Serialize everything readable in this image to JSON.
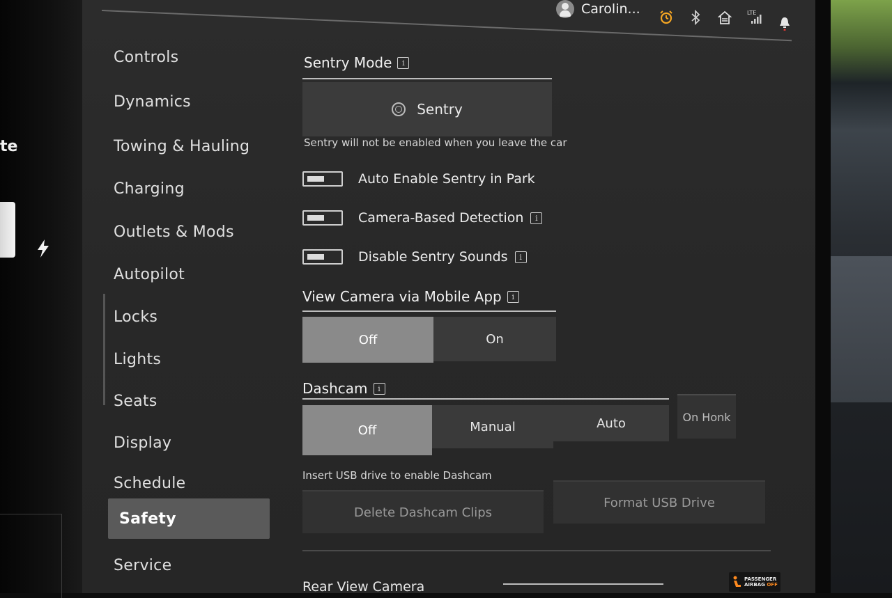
{
  "edge_fragment": "te",
  "user": {
    "name": "Carolin..."
  },
  "status_icons": [
    "alarm-clock-icon",
    "bluetooth-icon",
    "homelink-icon",
    "lte-signal-icon",
    "bell-icon"
  ],
  "status": {
    "network": "LTE"
  },
  "sidebar": {
    "items": [
      {
        "label": "Controls"
      },
      {
        "label": "Dynamics"
      },
      {
        "label": "Towing & Hauling"
      },
      {
        "label": "Charging"
      },
      {
        "label": "Outlets & Mods"
      },
      {
        "label": "Autopilot"
      },
      {
        "label": "Locks"
      },
      {
        "label": "Lights"
      },
      {
        "label": "Seats"
      },
      {
        "label": "Display"
      },
      {
        "label": "Schedule"
      },
      {
        "label": "Safety",
        "active": true
      },
      {
        "label": "Service"
      }
    ]
  },
  "sentry": {
    "title": "Sentry Mode",
    "button_label": "Sentry",
    "note": "Sentry will not be enabled when you leave the car",
    "toggles": [
      {
        "label": "Auto Enable Sentry in Park",
        "on": false
      },
      {
        "label": "Camera-Based Detection",
        "on": false
      },
      {
        "label": "Disable Sentry Sounds",
        "on": false
      }
    ]
  },
  "view_camera": {
    "title": "View Camera via Mobile App",
    "options": [
      "Off",
      "On"
    ],
    "selected": "Off"
  },
  "dashcam": {
    "title": "Dashcam",
    "options": [
      "Off",
      "Manual",
      "Auto"
    ],
    "extra_option": "On Honk",
    "selected": "Off",
    "usb_note": "Insert USB drive to enable Dashcam",
    "delete_label": "Delete Dashcam Clips",
    "format_label": "Format USB Drive"
  },
  "rear_view": {
    "title": "Rear View Camera"
  },
  "airbag": {
    "line1": "PASSENGER",
    "line2a": "AIRBAG",
    "line2b": "OFF"
  },
  "info_glyph": "i",
  "colors": {
    "accent_alarm": "#f5a623",
    "airbag_off": "#ff8a1f",
    "selected_segment": "#8a8a8a"
  }
}
